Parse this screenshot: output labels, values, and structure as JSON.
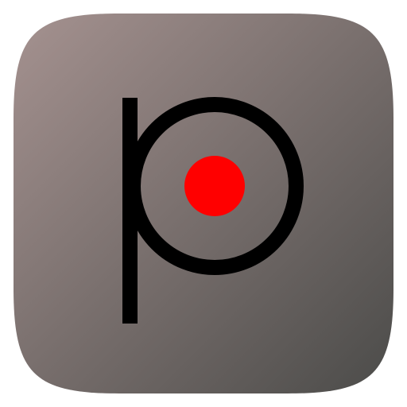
{
  "app_icon": {
    "icon_name": "p-record-app-icon",
    "background_gradient": {
      "start_color": "#a59290",
      "end_color": "#4b4b49"
    },
    "letter_color": "#000000",
    "dot_color": "#ff0000"
  }
}
